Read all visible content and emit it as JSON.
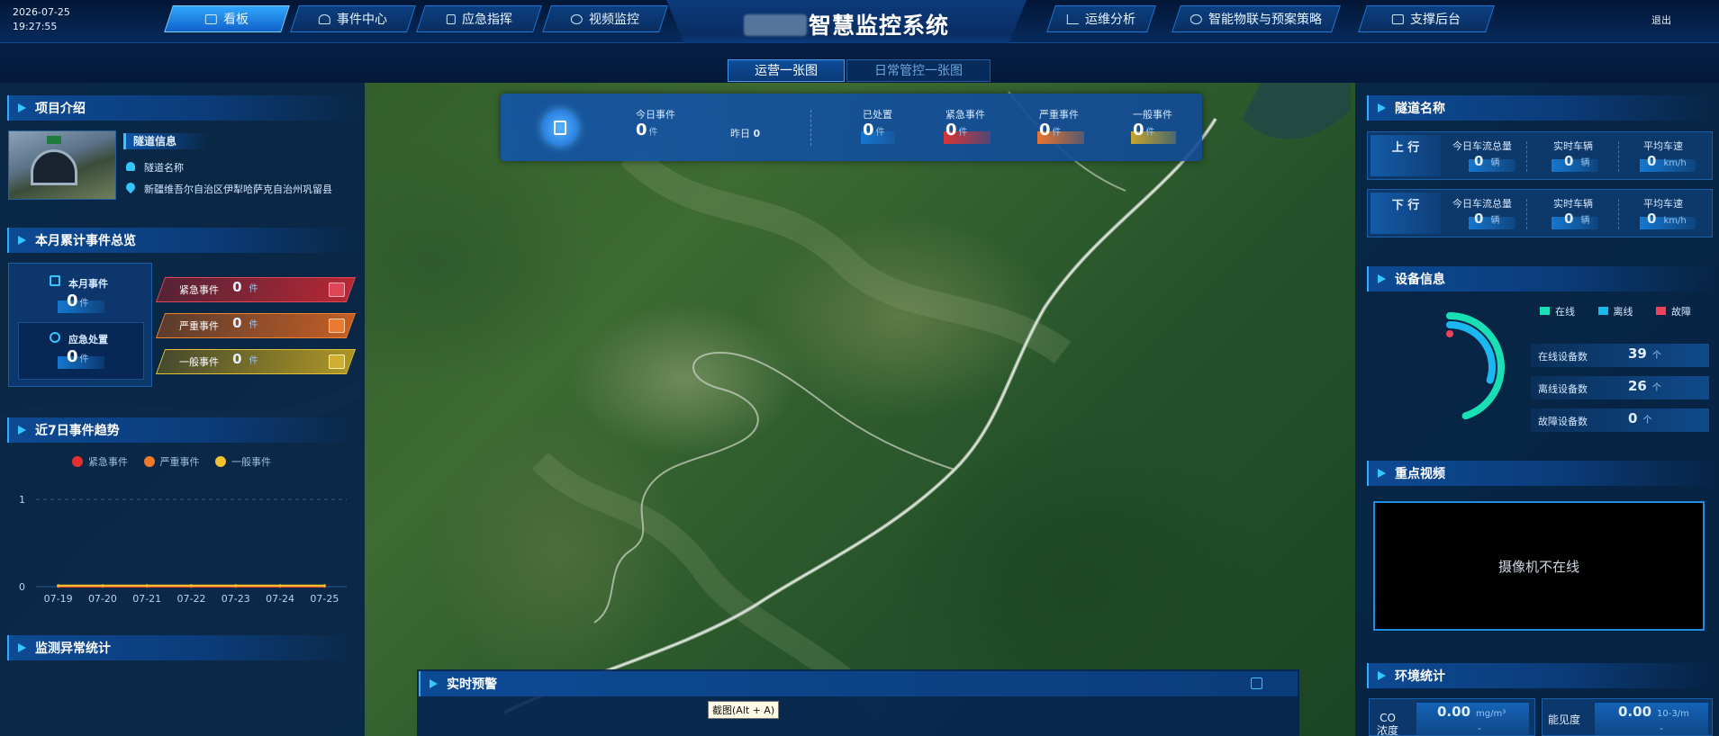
{
  "header": {
    "date": "2026-07-25",
    "time": "19:27:55",
    "title": "智慧监控系统",
    "logout": "退出",
    "nav_left": [
      {
        "label": "看板",
        "active": true
      },
      {
        "label": "事件中心",
        "active": false
      },
      {
        "label": "应急指挥",
        "active": false
      },
      {
        "label": "视频监控",
        "active": false
      }
    ],
    "nav_right": [
      {
        "label": "运维分析"
      },
      {
        "label": "智能物联与预案策略"
      },
      {
        "label": "支撑后台"
      }
    ]
  },
  "subtabs": [
    {
      "label": "运营一张图",
      "active": true
    },
    {
      "label": "日常管控一张图",
      "active": false
    }
  ],
  "project": {
    "title": "项目介绍",
    "subtitle": "隧道信息",
    "tunnel_name_label": "隧道名称",
    "location": "新疆维吾尔自治区伊犁哈萨克自治州巩留县"
  },
  "monthly": {
    "title": "本月累计事件总览",
    "month_events_label": "本月事件",
    "month_events_value": "0",
    "emergency_handle_label": "应急处置",
    "emergency_handle_value": "0",
    "unit": "件",
    "rows": [
      {
        "label": "紧急事件",
        "value": "0",
        "unit": "件"
      },
      {
        "label": "严重事件",
        "value": "0",
        "unit": "件"
      },
      {
        "label": "一般事件",
        "value": "0",
        "unit": "件"
      }
    ]
  },
  "trend": {
    "title": "近7日事件趋势",
    "legend": [
      {
        "name": "紧急事件",
        "color": "#e63030"
      },
      {
        "name": "严重事件",
        "color": "#f07a2a"
      },
      {
        "name": "一般事件",
        "color": "#f2c12e"
      }
    ]
  },
  "chart_data": {
    "type": "line",
    "title": "近7日事件趋势",
    "categories": [
      "07-19",
      "07-20",
      "07-21",
      "07-22",
      "07-23",
      "07-24",
      "07-25"
    ],
    "series": [
      {
        "name": "紧急事件",
        "values": [
          0,
          0,
          0,
          0,
          0,
          0,
          0
        ],
        "color": "#e63030"
      },
      {
        "name": "严重事件",
        "values": [
          0,
          0,
          0,
          0,
          0,
          0,
          0
        ],
        "color": "#f07a2a"
      },
      {
        "name": "一般事件",
        "values": [
          0,
          0,
          0,
          0,
          0,
          0,
          0
        ],
        "color": "#f2c12e"
      }
    ],
    "yticks": [
      "0",
      "1"
    ],
    "ylim": [
      0,
      1
    ],
    "legend": "top-center",
    "grid": true
  },
  "anomaly": {
    "title": "监测异常统计"
  },
  "kpi": {
    "today_label": "今日事件",
    "today_value": "0",
    "unit": "件",
    "yesterday_label": "昨日",
    "yesterday_value": "0",
    "items": [
      {
        "label": "已处置",
        "value": "0",
        "unit": "件",
        "color": "#1677cf"
      },
      {
        "label": "紧急事件",
        "value": "0",
        "unit": "件",
        "color": "#d83535"
      },
      {
        "label": "严重事件",
        "value": "0",
        "unit": "件",
        "color": "#e8742c"
      },
      {
        "label": "一般事件",
        "value": "0",
        "unit": "件",
        "color": "#c6a52a"
      }
    ]
  },
  "realtime": {
    "title": "实时预警"
  },
  "tunnel": {
    "title": "隧道名称",
    "directions": [
      {
        "name": "上 行",
        "flow_label": "今日车流总量",
        "flow_value": "0",
        "flow_unit": "辆",
        "realtime_label": "实时车辆",
        "realtime_value": "0",
        "realtime_unit": "辆",
        "speed_label": "平均车速",
        "speed_value": "0",
        "speed_unit": "km/h"
      },
      {
        "name": "下 行",
        "flow_label": "今日车流总量",
        "flow_value": "0",
        "flow_unit": "辆",
        "realtime_label": "实时车辆",
        "realtime_value": "0",
        "realtime_unit": "辆",
        "speed_label": "平均车速",
        "speed_value": "0",
        "speed_unit": "km/h"
      }
    ]
  },
  "device": {
    "title": "设备信息",
    "legend": [
      {
        "name": "在线",
        "color": "#19e0b4"
      },
      {
        "name": "离线",
        "color": "#1bb8f0"
      },
      {
        "name": "故障",
        "color": "#f0405a"
      }
    ],
    "online_label": "在线设备数",
    "online_value": "39",
    "offline_label": "离线设备数",
    "offline_value": "26",
    "fault_label": "故障设备数",
    "fault_value": "0",
    "unit": "个"
  },
  "video": {
    "title": "重点视频",
    "status": "摄像机不在线"
  },
  "env": {
    "title": "环境统计",
    "co_label": "CO浓度",
    "co_value": "0.00",
    "co_unit": "mg/m³",
    "co_sub": "-",
    "vis_label": "能见度",
    "vis_value": "0.00",
    "vis_unit": "10-3/m",
    "vis_sub": "-"
  },
  "tooltip": "截图(Alt + A)"
}
